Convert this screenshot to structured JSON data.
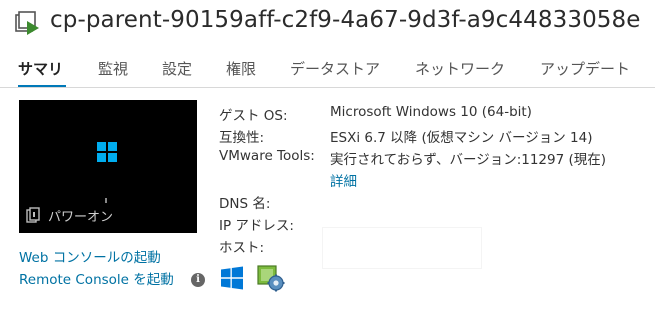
{
  "header": {
    "vm_name": "cp-parent-90159aff-c2f9-4a67-9d3f-a9c44833058e",
    "vm_icon": "vm-running-icon"
  },
  "tabs": [
    {
      "label": "サマリ",
      "active": true
    },
    {
      "label": "監視"
    },
    {
      "label": "設定"
    },
    {
      "label": "権限"
    },
    {
      "label": "データストア"
    },
    {
      "label": "ネットワーク"
    },
    {
      "label": "アップデート"
    }
  ],
  "console": {
    "power_state": "パワーオン",
    "screen_logo": "windows-icon"
  },
  "links": {
    "web_console": "Web コンソールの起動",
    "remote_console": "Remote Console を起動"
  },
  "details": {
    "guest_os_label": "ゲスト OS:",
    "guest_os_value": "Microsoft Windows 10 (64-bit)",
    "compat_label": "互換性:",
    "compat_value": "ESXi 6.7 以降 (仮想マシン バージョン 14)",
    "tools_label": "VMware Tools:",
    "tools_value": "実行されておらず、バージョン:11297 (現在)",
    "tools_detail_link": "詳細",
    "dns_label": "DNS 名:",
    "ip_label": "IP アドレス:",
    "host_label": "ホスト:"
  },
  "colors": {
    "accent": "#0079b8",
    "link": "#0072a3",
    "windows_blue": "#00adef"
  }
}
